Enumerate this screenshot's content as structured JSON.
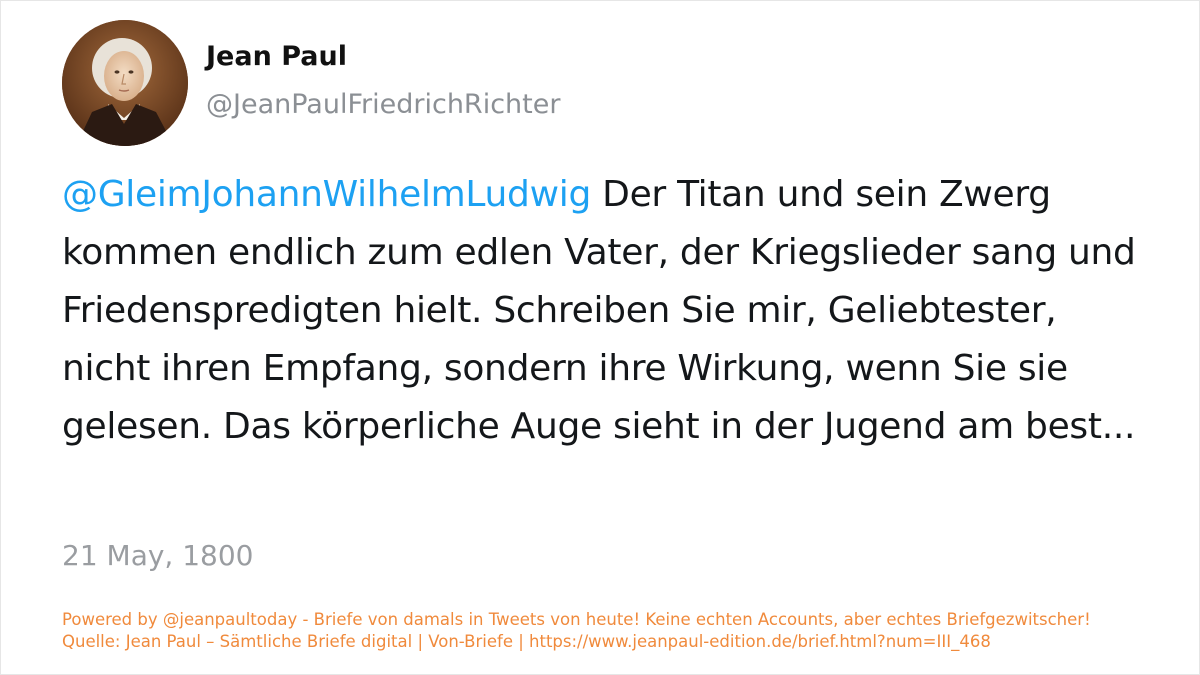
{
  "profile": {
    "display_name": "Jean Paul",
    "handle": "@JeanPaulFriedrichRichter",
    "avatar_icon": "portrait-avatar"
  },
  "tweet": {
    "mention": "@GleimJohannWilhelmLudwig",
    "text": " Der Titan und sein Zwerg kommen endlich zum edlen Vater, der Kriegslieder sang und Friedenspredigten hielt. Schreiben Sie mir, Geliebtester, nicht ihren Empfang, sondern ihre Wirkung, wenn Sie sie gelesen. Das körperliche Auge sieht in der Jugend am best...",
    "date": "21 May, 1800"
  },
  "footer": {
    "line1": "Powered by @jeanpaultoday - Briefe von damals in Tweets von heute! Keine echten Accounts, aber echtes Briefgezwitscher!",
    "line2": "Quelle: Jean Paul – Sämtliche Briefe digital | Von-Briefe | https://www.jeanpaul-edition.de/brief.html?num=III_468"
  },
  "colors": {
    "mention": "#1da1f2",
    "text": "#14171a",
    "muted": "#8b8f94",
    "footer": "#f08a3c"
  }
}
